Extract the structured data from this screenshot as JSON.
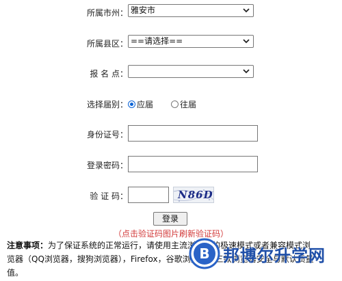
{
  "form": {
    "city": {
      "label": "所属市州：",
      "value": "雅安市"
    },
    "county": {
      "label": "所属县区：",
      "value": "==请选择=="
    },
    "site": {
      "label": "报 名 点：",
      "value": ""
    },
    "grade": {
      "label": "选择届别：",
      "options": [
        "应届",
        "往届"
      ],
      "selected": "应届"
    },
    "id_number": {
      "label": "身份证号：",
      "value": ""
    },
    "password": {
      "label": "登录密码：",
      "value": ""
    },
    "captcha": {
      "label": "验 证 码：",
      "value": "",
      "image_text": "N86D"
    },
    "login_button": "登录",
    "captcha_hint": "（点击验证码图片刷新验证码）"
  },
  "notice": {
    "title": "注意事项：",
    "text": "为了保证系统的正常运行，请使用主流浏览器的极速模式或者兼容模式浏览器（QQ浏览器，搜狗浏览器），Firefox，谷歌浏览器，三款浏览器安全与默认质量值。"
  },
  "watermark": {
    "text": "邦博尔升学网",
    "mark": "B"
  }
}
